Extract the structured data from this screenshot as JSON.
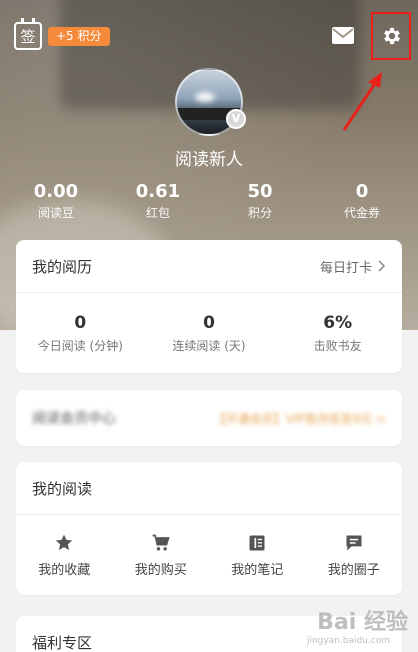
{
  "top_bar": {
    "sign_label": "签",
    "points_badge": "+5 积分"
  },
  "profile": {
    "username": "阅读新人"
  },
  "stats": [
    {
      "value": "0.00",
      "label": "阅读豆"
    },
    {
      "value": "0.61",
      "label": "红包"
    },
    {
      "value": "50",
      "label": "积分"
    },
    {
      "value": "0",
      "label": "代金券"
    }
  ],
  "history": {
    "title": "我的阅历",
    "checkin_label": "每日打卡",
    "items": [
      {
        "value": "0",
        "label": "今日阅读 (分钟)"
      },
      {
        "value": "0",
        "label": "连续阅读 (天)"
      },
      {
        "value": "6%",
        "label": "击败书友"
      }
    ]
  },
  "member": {
    "title": "阅读会员中心",
    "promo": "【开通会员】VIP首月低至9元 >"
  },
  "reading": {
    "title": "我的阅读",
    "items": [
      {
        "label": "我的收藏",
        "icon": "star-icon"
      },
      {
        "label": "我的购买",
        "icon": "cart-icon"
      },
      {
        "label": "我的笔记",
        "icon": "notebook-icon"
      },
      {
        "label": "我的圈子",
        "icon": "chat-icon"
      }
    ]
  },
  "welfare": {
    "title": "福利专区"
  },
  "watermark": {
    "main": "Bai 经验",
    "sub": "jingyan.baidu.com"
  },
  "colors": {
    "badge": "#f58a3a",
    "highlight_box": "#e8211b"
  }
}
